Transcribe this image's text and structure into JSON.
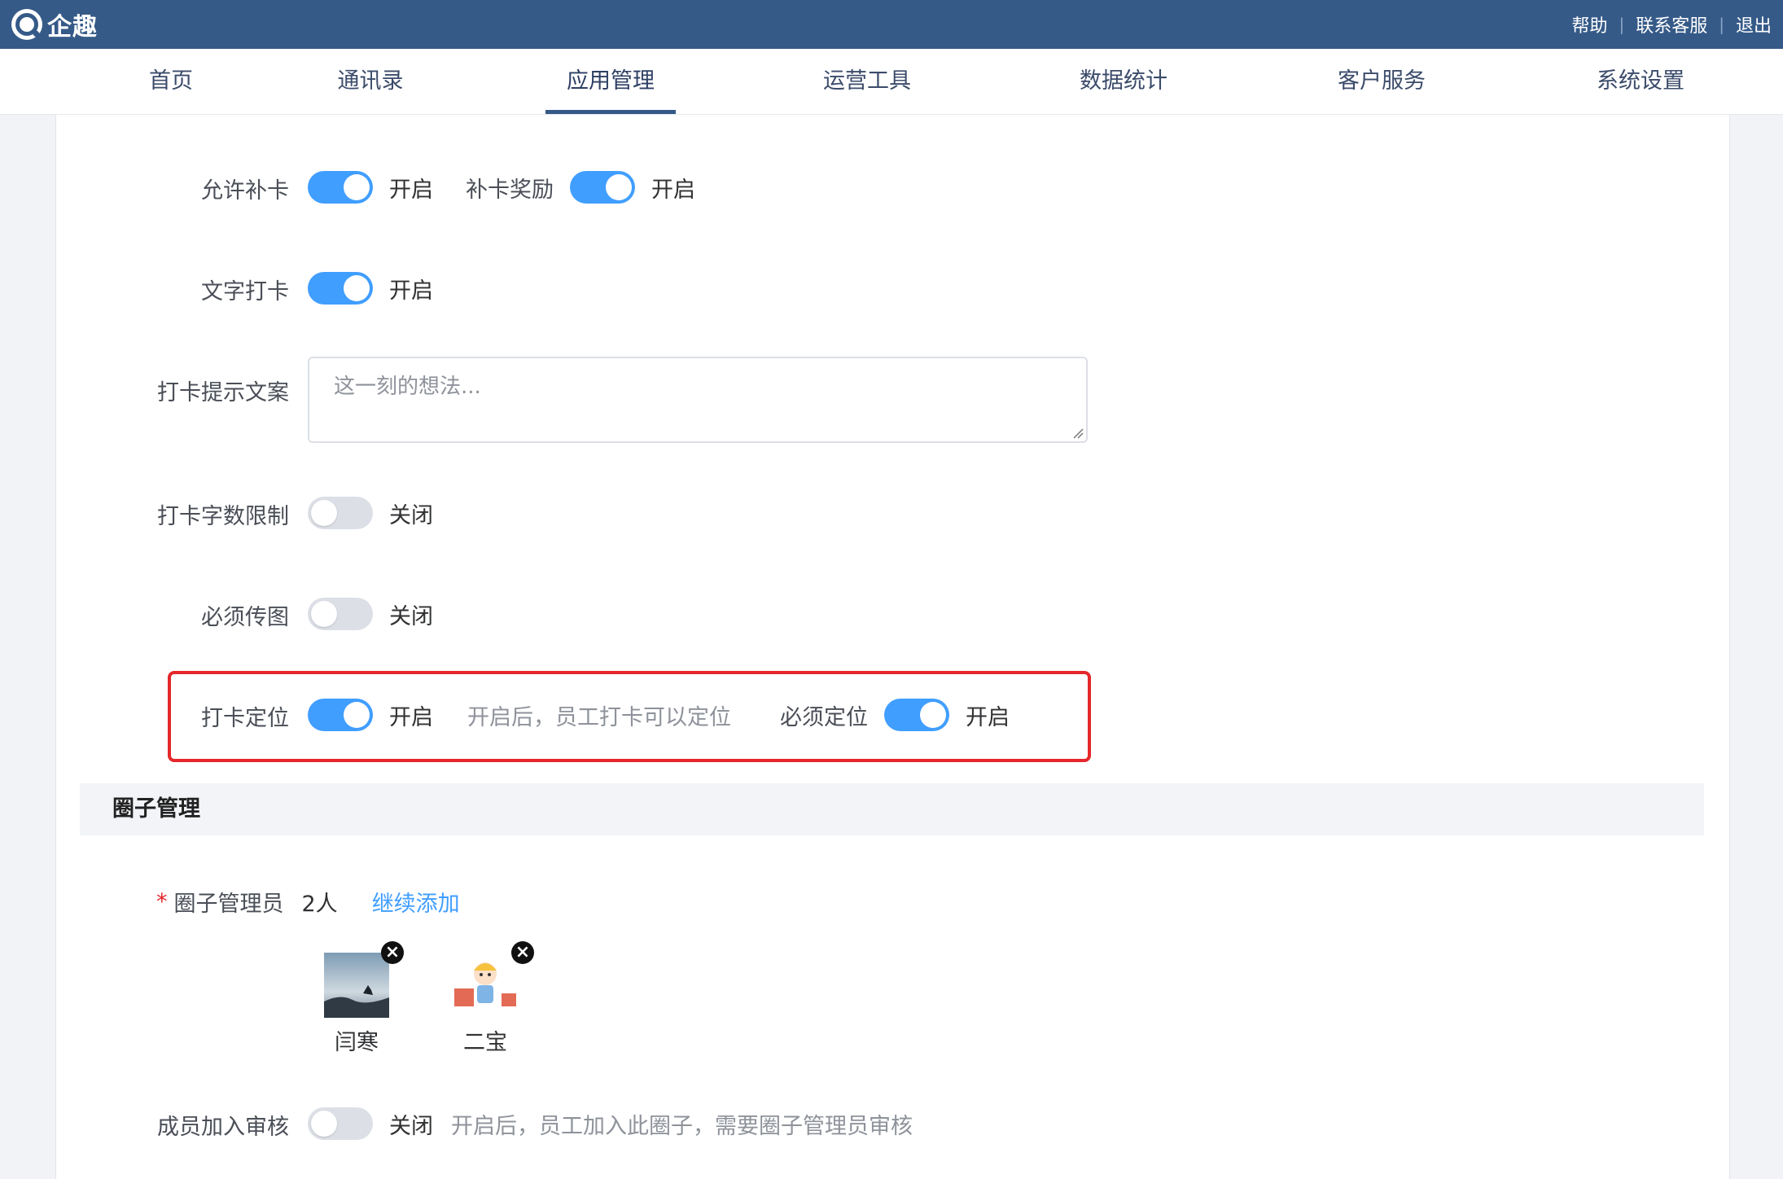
{
  "app": {
    "name": "企趣"
  },
  "top_links": {
    "help": "帮助",
    "sep": "|",
    "contact": "联系客服",
    "logout": "退出"
  },
  "nav": {
    "items": [
      {
        "label": "首页"
      },
      {
        "label": "通讯录"
      },
      {
        "label": "应用管理"
      },
      {
        "label": "运营工具"
      },
      {
        "label": "数据统计"
      },
      {
        "label": "客户服务"
      },
      {
        "label": "系统设置"
      }
    ],
    "active": "应用管理"
  },
  "settings": {
    "allow_makeup": {
      "label": "允许补卡",
      "state": "开启",
      "on": true
    },
    "makeup_reward": {
      "label": "补卡奖励",
      "state": "开启",
      "on": true
    },
    "text_checkin": {
      "label": "文字打卡",
      "state": "开启",
      "on": true
    },
    "prompt_text": {
      "label": "打卡提示文案",
      "placeholder": "这一刻的想法..."
    },
    "word_limit": {
      "label": "打卡字数限制",
      "state": "关闭",
      "on": false
    },
    "require_image": {
      "label": "必须传图",
      "state": "关闭",
      "on": false
    },
    "location": {
      "label": "打卡定位",
      "state": "开启",
      "on": true,
      "hint": "开启后，员工打卡可以定位"
    },
    "require_location": {
      "label": "必须定位",
      "state": "开启",
      "on": true
    }
  },
  "circle": {
    "section_title": "圈子管理",
    "admins": {
      "required_mark": "*",
      "label": "圈子管理员",
      "count": "2人",
      "add_link": "继续添加",
      "members": [
        {
          "name": "闫寒"
        },
        {
          "name": "二宝"
        }
      ]
    },
    "join_review": {
      "label": "成员加入审核",
      "state": "关闭",
      "on": false,
      "hint": "开启后，员工加入此圈子，需要圈子管理员审核"
    }
  },
  "colors": {
    "topbar": "#355a88",
    "toggle_on": "#409eff",
    "toggle_off": "#dcdfe6",
    "highlight": "#e5262a",
    "link": "#409eff"
  }
}
